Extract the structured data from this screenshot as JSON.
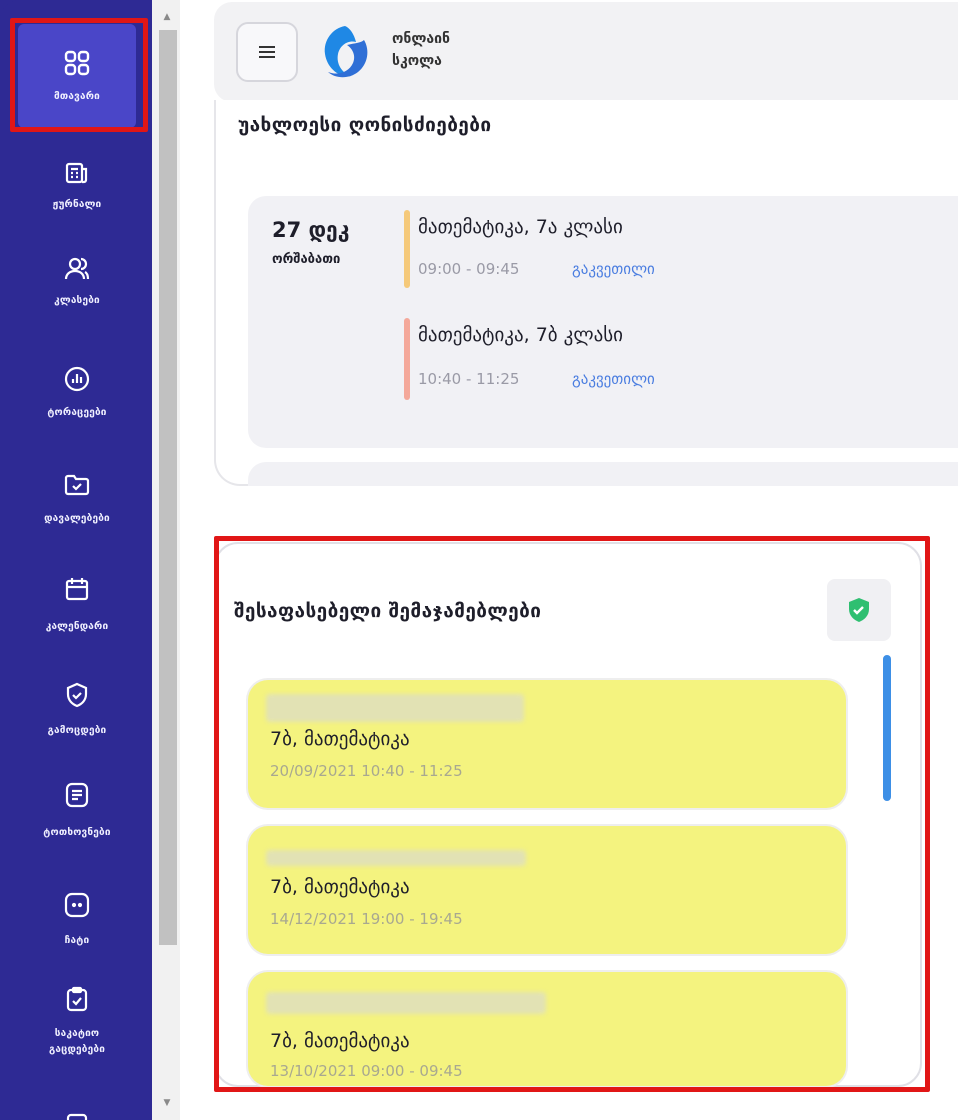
{
  "brand": {
    "line1": "ონლაინ",
    "line2": "სკოლა"
  },
  "sidebar": {
    "items": [
      {
        "label": "მთავარი",
        "icon": "dashboard-grid-icon"
      },
      {
        "label": "ჟურნალი",
        "icon": "journal-icon"
      },
      {
        "label": "კლასები",
        "icon": "users-icon"
      },
      {
        "label": "ტორაცეები",
        "icon": "chart-icon"
      },
      {
        "label": "დავალებები",
        "icon": "folder-check-icon"
      },
      {
        "label": "კალენდარი",
        "icon": "calendar-icon"
      },
      {
        "label": "გამოცდები",
        "icon": "shield-check-icon"
      },
      {
        "label": "ტოთხოვნები",
        "icon": "document-icon"
      },
      {
        "label": "ჩატი",
        "icon": "chat-icon"
      },
      {
        "label": "საკატიო",
        "label2": "გაცდებები",
        "icon": "clipboard-check-icon"
      }
    ]
  },
  "upcoming": {
    "title": "უახლოესი ღონისძიებები",
    "date": "27 დეკ",
    "weekday": "ორშაბათი",
    "events": [
      {
        "title": "მათემატიკა, 7ა კლასი",
        "time": "09:00 - 09:45",
        "link": "გაკვეთილი",
        "color": "#f5c97a"
      },
      {
        "title": "მათემატიკა, 7ბ კლასი",
        "time": "10:40 - 11:25",
        "link": "გაკვეთილი",
        "color": "#f4a89a"
      }
    ]
  },
  "assessments": {
    "title": "შესაფასებელი შემაჯამებლები",
    "items": [
      {
        "title": "7ბ, მათემატიკა",
        "time": "20/09/2021 10:40 - 11:25"
      },
      {
        "title": "7ბ, მათემატიკა",
        "time": "14/12/2021 19:00 - 19:45"
      },
      {
        "title": "7ბ, მათემატიკა",
        "time": "13/10/2021 09:00 - 09:45"
      }
    ]
  },
  "colors": {
    "sidebar": "#2e2a94",
    "highlight": "#e11616",
    "card": "#f4f37f",
    "accent": "#4a7de0"
  }
}
